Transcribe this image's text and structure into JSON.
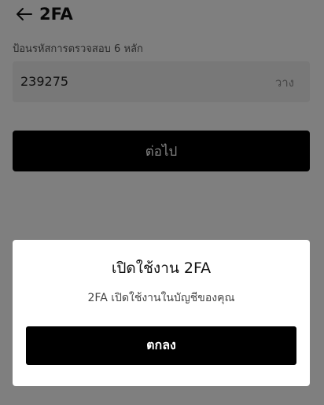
{
  "header": {
    "title": "2FA",
    "back_icon": "arrow-left-icon"
  },
  "form": {
    "label": "ป้อนรหัสการตรวจสอบ 6 หลัก",
    "code_value": "239275",
    "paste_label": "วาง",
    "next_label": "ต่อไป"
  },
  "dialog": {
    "title": "เปิดใช้งาน 2FA",
    "message": "2FA เปิดใช้งานในบัญชีของคุณ",
    "ok_label": "ตกลง"
  },
  "colors": {
    "button_bg": "#000000",
    "overlay": "rgba(0,0,0,0.5)",
    "field_bg": "#f1f1f1"
  }
}
